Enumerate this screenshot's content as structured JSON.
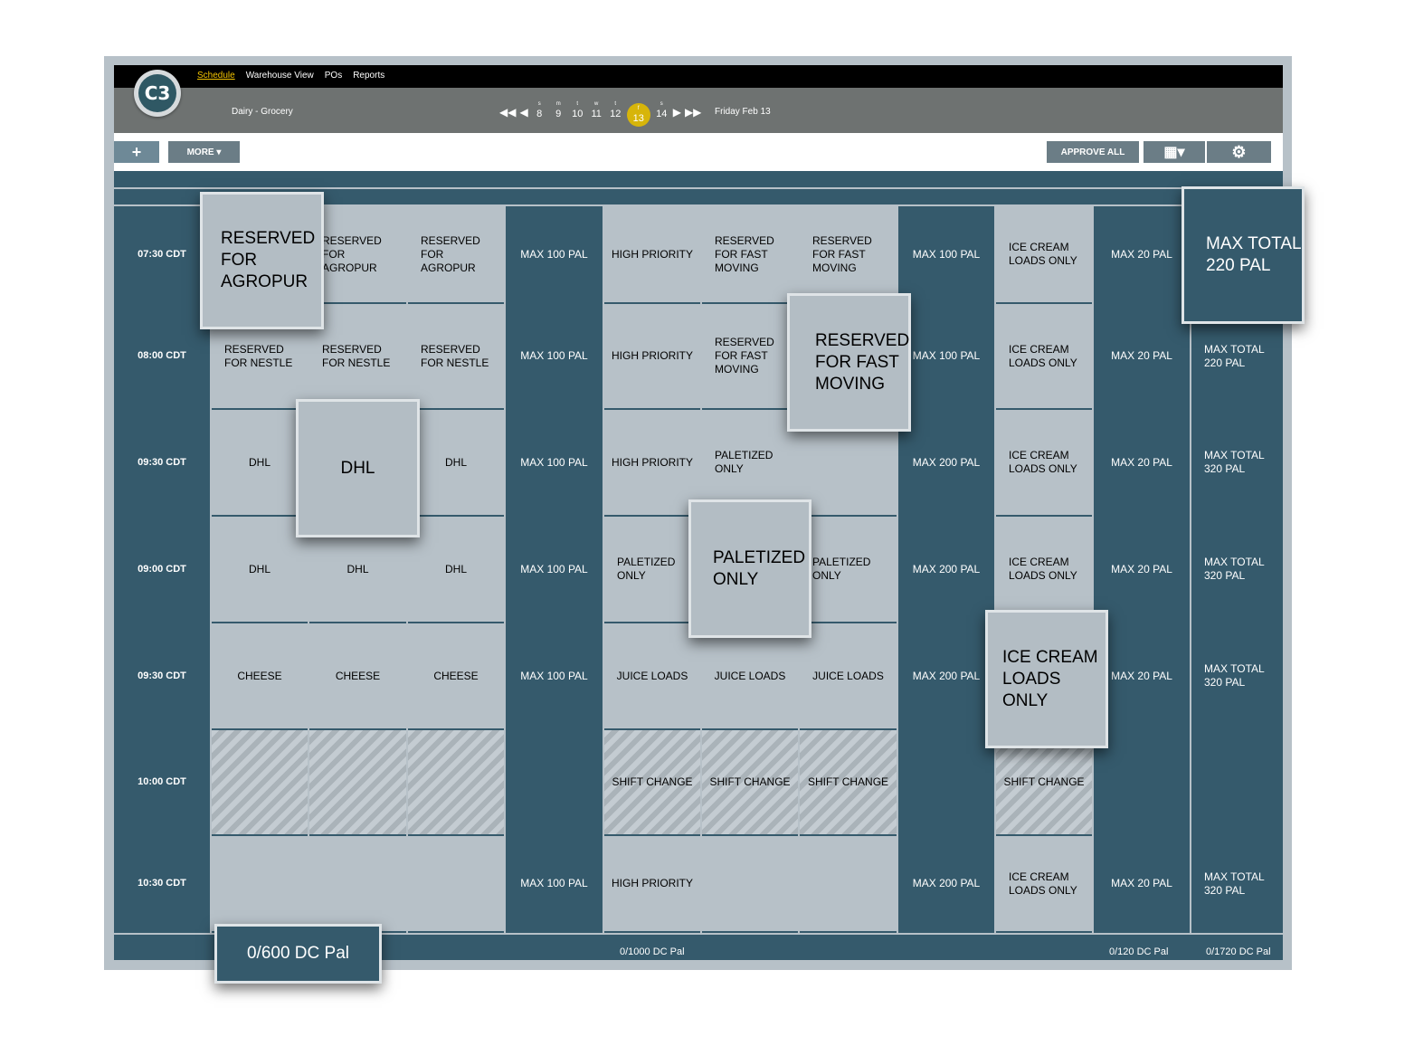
{
  "nav": {
    "items": [
      "Schedule",
      "Warehouse View",
      "POs",
      "Reports"
    ]
  },
  "logo": {
    "text": "C3"
  },
  "department": "Dairy - Grocery",
  "date_nav": {
    "days": [
      {
        "letter": "s",
        "num": "8"
      },
      {
        "letter": "m",
        "num": "9"
      },
      {
        "letter": "t",
        "num": "10"
      },
      {
        "letter": "w",
        "num": "11"
      },
      {
        "letter": "t",
        "num": "12"
      },
      {
        "letter": "f",
        "num": "13",
        "selected": true
      },
      {
        "letter": "s",
        "num": "14"
      }
    ],
    "current_date": "Friday Feb 13"
  },
  "toolbar": {
    "add": "+",
    "more": "MORE ▾",
    "approve_all": "APPROVE ALL",
    "layout": "▦▾",
    "settings": "⚙"
  },
  "rows": [
    {
      "time": "07:30 CDT",
      "cells": [
        {
          "t": "",
          "s": "light"
        },
        {
          "t": "RESERVED\nFOR\nAGROPUR",
          "s": "light left"
        },
        {
          "t": "RESERVED\nFOR\nAGROPUR",
          "s": "light left"
        },
        {
          "t": "MAX 100 PAL",
          "s": "dark"
        },
        {
          "t": "HIGH PRIORITY",
          "s": "light"
        },
        {
          "t": "RESERVED\nFOR FAST\nMOVING",
          "s": "light left"
        },
        {
          "t": "RESERVED\nFOR FAST\nMOVING",
          "s": "light left"
        },
        {
          "t": "MAX 100 PAL",
          "s": "dark"
        },
        {
          "t": "ICE CREAM\nLOADS ONLY",
          "s": "light left"
        },
        {
          "t": "MAX 20 PAL",
          "s": "dark"
        },
        {
          "t": "",
          "s": "dark"
        }
      ]
    },
    {
      "time": "08:00 CDT",
      "cells": [
        {
          "t": "RESERVED\nFOR NESTLE",
          "s": "light left"
        },
        {
          "t": "RESERVED\nFOR NESTLE",
          "s": "light left"
        },
        {
          "t": "RESERVED\nFOR NESTLE",
          "s": "light left"
        },
        {
          "t": "MAX 100 PAL",
          "s": "dark"
        },
        {
          "t": "HIGH PRIORITY",
          "s": "light"
        },
        {
          "t": "RESERVED\nFOR FAST\nMOVING",
          "s": "light left"
        },
        {
          "t": "",
          "s": "light"
        },
        {
          "t": "MAX 100 PAL",
          "s": "dark"
        },
        {
          "t": "ICE CREAM\nLOADS ONLY",
          "s": "light left"
        },
        {
          "t": "MAX 20 PAL",
          "s": "dark"
        },
        {
          "t": "MAX TOTAL\n220 PAL",
          "s": "dark left"
        }
      ]
    },
    {
      "time": "09:30 CDT",
      "cells": [
        {
          "t": "DHL",
          "s": "light"
        },
        {
          "t": "",
          "s": "light"
        },
        {
          "t": "DHL",
          "s": "light"
        },
        {
          "t": "MAX 100 PAL",
          "s": "dark"
        },
        {
          "t": "HIGH PRIORITY",
          "s": "light"
        },
        {
          "t": "PALETIZED\nONLY",
          "s": "light left"
        },
        {
          "t": "",
          "s": "light"
        },
        {
          "t": "MAX 200 PAL",
          "s": "dark"
        },
        {
          "t": "ICE CREAM\nLOADS ONLY",
          "s": "light left"
        },
        {
          "t": "MAX 20 PAL",
          "s": "dark"
        },
        {
          "t": "MAX TOTAL\n320 PAL",
          "s": "dark left"
        }
      ]
    },
    {
      "time": "09:00 CDT",
      "cells": [
        {
          "t": "DHL",
          "s": "light"
        },
        {
          "t": "DHL",
          "s": "light"
        },
        {
          "t": "DHL",
          "s": "light"
        },
        {
          "t": "MAX 100 PAL",
          "s": "dark"
        },
        {
          "t": "PALETIZED\nONLY",
          "s": "light left"
        },
        {
          "t": "",
          "s": "light"
        },
        {
          "t": "PALETIZED\nONLY",
          "s": "light left"
        },
        {
          "t": "MAX 200 PAL",
          "s": "dark"
        },
        {
          "t": "ICE CREAM\nLOADS ONLY",
          "s": "light left"
        },
        {
          "t": "MAX 20 PAL",
          "s": "dark"
        },
        {
          "t": "MAX TOTAL\n320 PAL",
          "s": "dark left"
        }
      ]
    },
    {
      "time": "09:30 CDT",
      "cells": [
        {
          "t": "CHEESE",
          "s": "light"
        },
        {
          "t": "CHEESE",
          "s": "light"
        },
        {
          "t": "CHEESE",
          "s": "light"
        },
        {
          "t": "MAX 100 PAL",
          "s": "dark"
        },
        {
          "t": "JUICE LOADS",
          "s": "light"
        },
        {
          "t": "JUICE LOADS",
          "s": "light"
        },
        {
          "t": "JUICE LOADS",
          "s": "light"
        },
        {
          "t": "MAX 200 PAL",
          "s": "dark"
        },
        {
          "t": "",
          "s": "light"
        },
        {
          "t": "MAX 20 PAL",
          "s": "dark"
        },
        {
          "t": "MAX TOTAL\n320 PAL",
          "s": "dark left"
        }
      ]
    },
    {
      "time": "10:00 CDT",
      "cells": [
        {
          "t": "",
          "s": "hatch"
        },
        {
          "t": "",
          "s": "hatch"
        },
        {
          "t": "",
          "s": "hatch"
        },
        {
          "t": "",
          "s": "dark"
        },
        {
          "t": "SHIFT CHANGE",
          "s": "hatch"
        },
        {
          "t": "SHIFT CHANGE",
          "s": "hatch"
        },
        {
          "t": "SHIFT CHANGE",
          "s": "hatch"
        },
        {
          "t": "",
          "s": "dark"
        },
        {
          "t": "SHIFT CHANGE",
          "s": "hatch"
        },
        {
          "t": "",
          "s": "dark"
        },
        {
          "t": "",
          "s": "dark"
        }
      ]
    },
    {
      "time": "10:30 CDT",
      "cells": [
        {
          "t": "",
          "s": "light"
        },
        {
          "t": "",
          "s": "light"
        },
        {
          "t": "",
          "s": "light"
        },
        {
          "t": "MAX 100 PAL",
          "s": "dark"
        },
        {
          "t": "HIGH PRIORITY",
          "s": "light"
        },
        {
          "t": "",
          "s": "light"
        },
        {
          "t": "",
          "s": "light"
        },
        {
          "t": "MAX 200 PAL",
          "s": "dark"
        },
        {
          "t": "ICE CREAM\nLOADS ONLY",
          "s": "light left"
        },
        {
          "t": "MAX 20 PAL",
          "s": "dark"
        },
        {
          "t": "MAX TOTAL\n320 PAL",
          "s": "dark left"
        }
      ]
    }
  ],
  "footer": {
    "middle": "0/1000 DC Pal",
    "col9": "0/120 DC Pal",
    "total": "0/1720 DC Pal"
  },
  "popouts": {
    "agropur": "RESERVED\nFOR\nAGROPUR",
    "max_total": "MAX TOTAL\n220 PAL",
    "fast_moving": "RESERVED\nFOR FAST\nMOVING",
    "dhl": "DHL",
    "paletized": "PALETIZED\nONLY",
    "ice_cream": "ICE CREAM\nLOADS ONLY",
    "dc_pal": "0/600 DC Pal"
  },
  "colors": {
    "dark_cell": "#355a6c",
    "light_cell": "#b7c1c8",
    "accent": "#d7b50a"
  }
}
